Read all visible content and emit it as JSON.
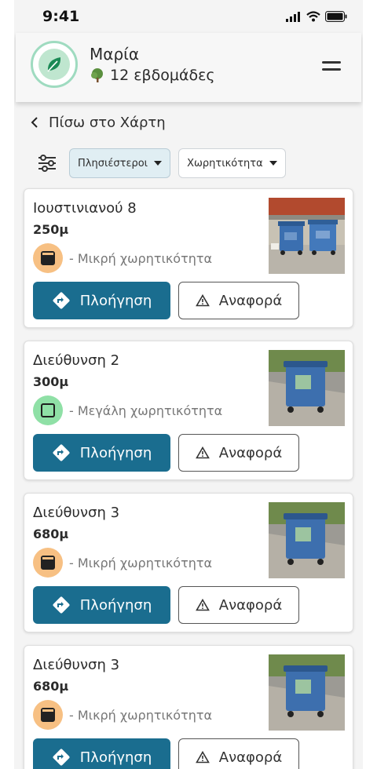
{
  "status": {
    "time": "9:41"
  },
  "header": {
    "username": "Μαρία",
    "weeks": "12 εβδομάδες"
  },
  "back": {
    "label": "Πίσω στο Χάρτη"
  },
  "filters": {
    "sort_label": "Πλησιέστεροι",
    "capacity_label": "Χωρητικότητα"
  },
  "colors": {
    "primary": "#1a6d8f",
    "small_capacity": "#f7c083",
    "large_capacity": "#8fe0a6",
    "active_chip": "#e0eef3"
  },
  "cards": [
    {
      "address": "Ιουστινιανού 8",
      "distance": "250μ",
      "capacity": "- Μικρή χωρητικότητα",
      "capacity_type": "small",
      "photo": "recycling-bins-street-photo",
      "nav_label": "Πλοήγηση",
      "report_label": "Αναφορά"
    },
    {
      "address": "Διεύθυνση 2",
      "distance": "300μ",
      "capacity": "- Μεγάλη χωρητικότητα",
      "capacity_type": "large",
      "photo": "blue-bin-photo",
      "nav_label": "Πλοήγηση",
      "report_label": "Αναφορά"
    },
    {
      "address": "Διεύθυνση 3",
      "distance": "680μ",
      "capacity": "- Μικρή χωρητικότητα",
      "capacity_type": "small",
      "photo": "blue-bin-photo",
      "nav_label": "Πλοήγηση",
      "report_label": "Αναφορά"
    },
    {
      "address": "Διεύθυνση 3",
      "distance": "680μ",
      "capacity": "- Μικρή χωρητικότητα",
      "capacity_type": "small",
      "photo": "blue-bin-photo",
      "nav_label": "Πλοήγηση",
      "report_label": "Αναφορά"
    }
  ]
}
